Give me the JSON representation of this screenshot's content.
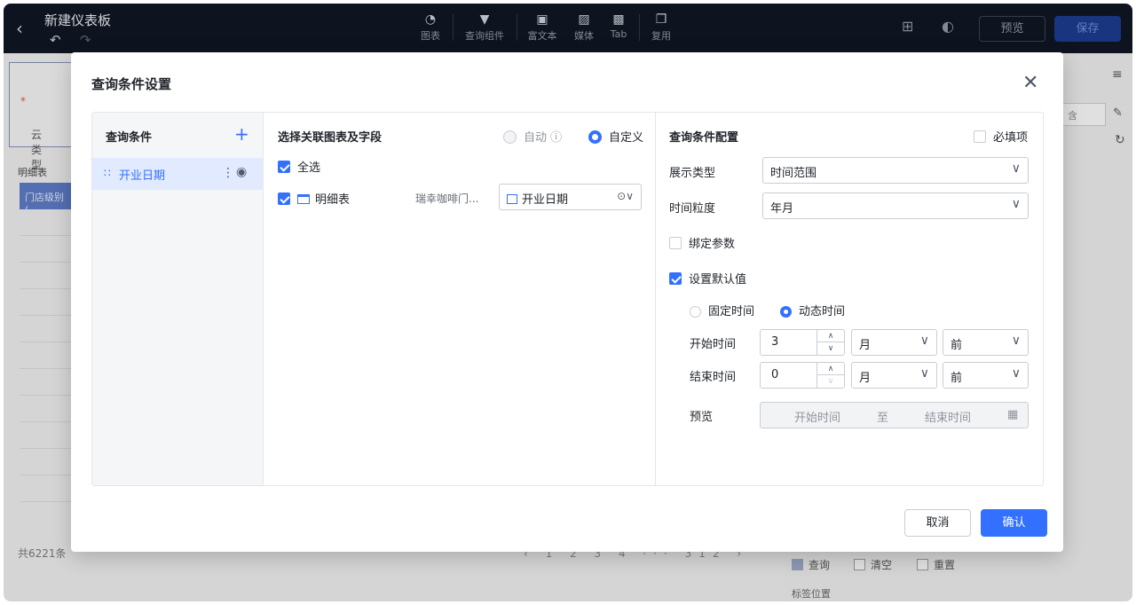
{
  "topbar": {
    "back_icon": "chevron-left-icon",
    "title": "新建仪表板",
    "tools": [
      {
        "label": "图表",
        "icon": "chart-icon"
      },
      {
        "label": "查询组件",
        "icon": "filter-icon"
      },
      {
        "label": "富文本",
        "icon": "text-icon"
      },
      {
        "label": "媒体",
        "icon": "image-icon"
      },
      {
        "label": "Tab",
        "icon": "tab-icon"
      },
      {
        "label": "复用",
        "icon": "copy-icon"
      }
    ],
    "preview_label": "预览",
    "save_label": "保存"
  },
  "background": {
    "filter_label": "云类型",
    "required_mark": "*",
    "detail_label": "明细表",
    "store_tag": "门店级别 (",
    "total": "共6221条",
    "pager": "‹ 1 2 3 4 ··· 312 ›",
    "chk_query": "查询",
    "chk_clear": "清空",
    "chk_reset": "重置",
    "label_position": "标签位置",
    "select_text": "含"
  },
  "modal": {
    "title": "查询条件设置",
    "conditions": {
      "header": "查询条件",
      "items": [
        {
          "label": "开业日期"
        }
      ]
    },
    "fields": {
      "header": "选择关联图表及字段",
      "mode_auto": "自动",
      "mode_custom": "自定义",
      "select_all": "全选",
      "table_name": "明细表",
      "table_source": "瑞幸咖啡门...",
      "field_value": "开业日期"
    },
    "config": {
      "header": "查询条件配置",
      "required_label": "必填项",
      "display_type_label": "展示类型",
      "display_type_value": "时间范围",
      "granularity_label": "时间粒度",
      "granularity_value": "年月",
      "bind_param_label": "绑定参数",
      "default_value_label": "设置默认值",
      "fixed_time": "固定时间",
      "dynamic_time": "动态时间",
      "start_label": "开始时间",
      "start_value": "3",
      "start_unit": "月",
      "start_dir": "前",
      "end_label": "结束时间",
      "end_value": "0",
      "end_unit": "月",
      "end_dir": "前",
      "preview_label": "预览",
      "preview_start": "开始时间",
      "preview_to": "至",
      "preview_end": "结束时间"
    },
    "cancel_label": "取消",
    "ok_label": "确认"
  }
}
